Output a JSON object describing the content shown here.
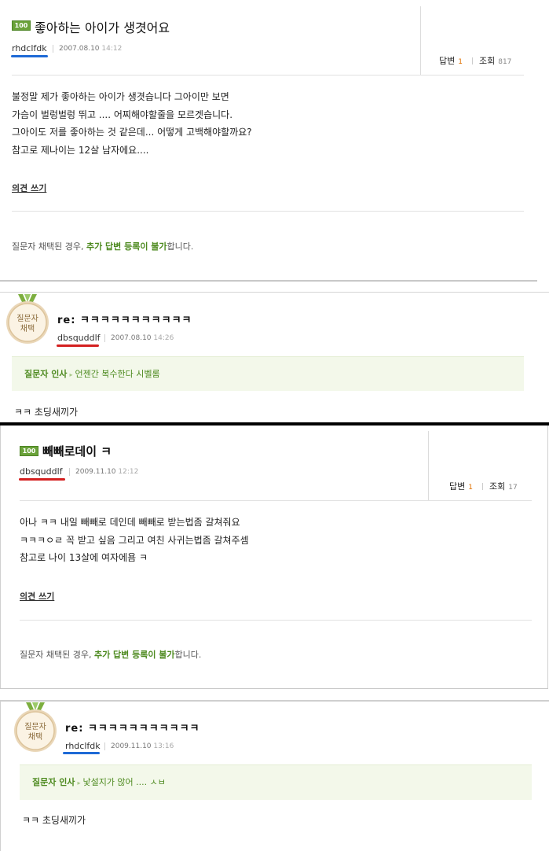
{
  "question1": {
    "badge": "100",
    "title": "좋아하는 아이가 생겻어요",
    "user": "rhdclfdk",
    "date": "2007.08.10",
    "time": "14:12",
    "answers_label": "답변",
    "answers_count": "1",
    "views_label": "조회",
    "views_count": "817",
    "body": [
      "불정말 제가 좋아하는 아이가 생겻습니다 그아이만 보면",
      "가슴이 벌렁벌렁 뛰고 .... 어찌해야할줄을 모르겟습니다.",
      "그아이도 저를 좋아하는 것 같은데... 어떻게 고백해야할까요?",
      "참고로 제나이는 12살 남자에요...."
    ],
    "opinion": "의견 쓰기",
    "notice_prefix": "질문자 채택된 경우,",
    "notice_em": "추가 답변 등록이 불가",
    "notice_suffix": "합니다.",
    "underline_color": "#1e6ad6"
  },
  "reply1": {
    "medal_text": [
      "질문자",
      "채택"
    ],
    "title": "re: ㅋㅋㅋㅋㅋㅋㅋㅋㅋㅋㅋ",
    "user": "dbsquddlf",
    "date": "2007.08.10",
    "time": "14:26",
    "greet_label": "질문자 인사",
    "greet_msg": "언젠간 복수한다 시벨롬",
    "body": "ㅋㅋ 초딩새끼가",
    "underline_color": "#d42020"
  },
  "question2": {
    "badge": "100",
    "title": "빼빼로데이 ㅋ",
    "user": "dbsquddlf",
    "date": "2009.11.10",
    "time": "12:12",
    "answers_label": "답변",
    "answers_count": "1",
    "views_label": "조회",
    "views_count": "17",
    "body": [
      "아나 ㅋㅋ 내일 빼빼로 데인데 빼빼로 받는법좀 갈쳐줘요",
      "ㅋㅋㅋㅇㄹ 꼭 받고 싶음 그리고 여친 사귀는법좀 갈쳐주셈",
      "참고로 나이 13살에 여자에욤 ㅋ"
    ],
    "opinion": "의견 쓰기",
    "notice_prefix": "질문자 채택된 경우,",
    "notice_em": "추가 답변 등록이 불가",
    "notice_suffix": "합니다.",
    "underline_color": "#d42020"
  },
  "reply2": {
    "medal_text": [
      "질문자",
      "채택"
    ],
    "title": "re: ㅋㅋㅋㅋㅋㅋㅋㅋㅋㅋㅋ",
    "user": "rhdclfdk",
    "date": "2009.11.10",
    "time": "13:16",
    "greet_label": "질문자 인사",
    "greet_msg": "낯설지가 않어 .... ㅅㅂ",
    "body": "ㅋㅋ 초딩새끼가",
    "underline_color": "#1e6ad6"
  }
}
